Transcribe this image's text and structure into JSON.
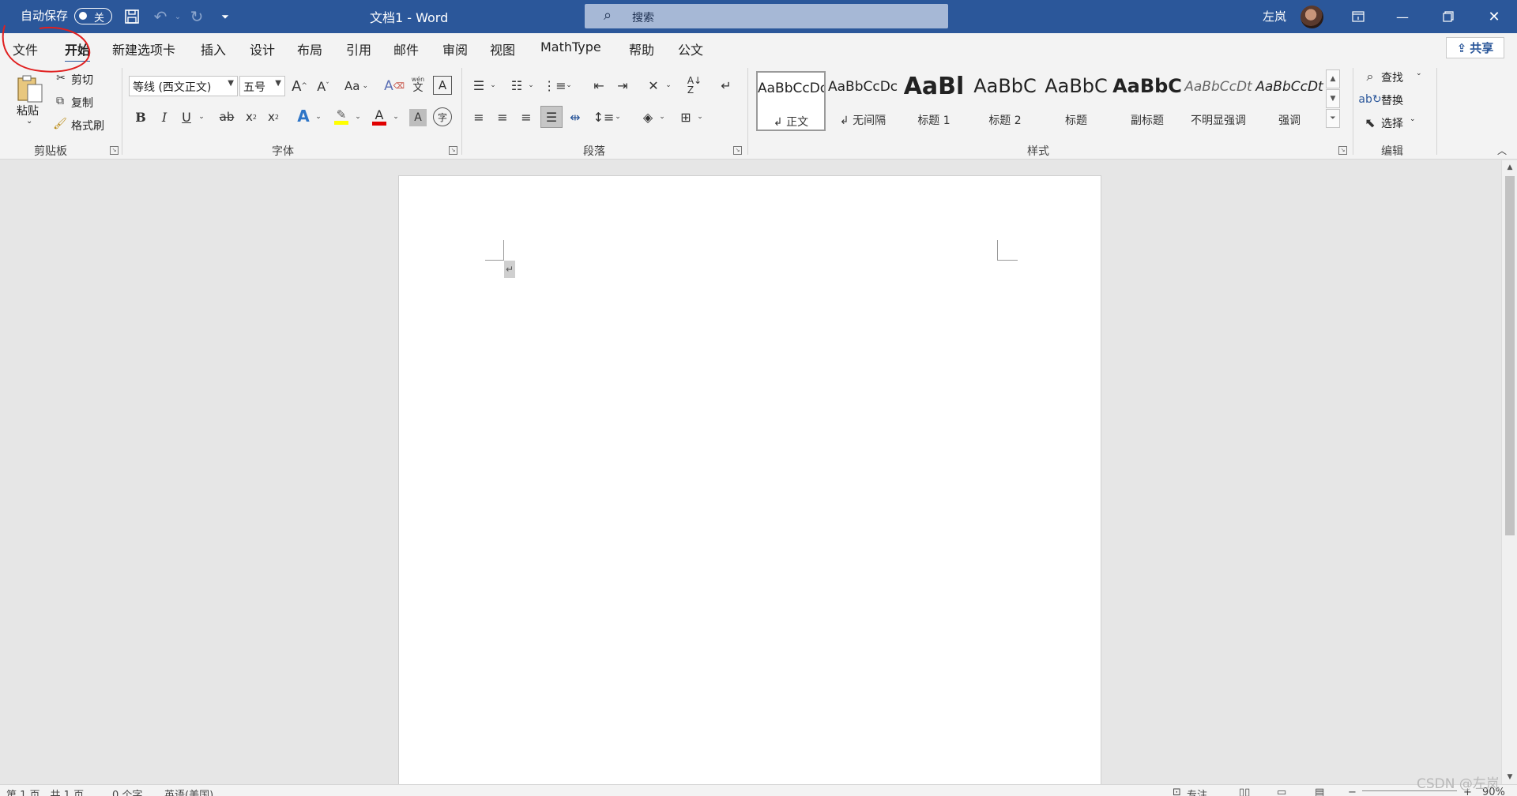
{
  "titlebar": {
    "autosave_label": "自动保存",
    "autosave_state": "关",
    "doc_title": "文档1  -  Word",
    "search_placeholder": "搜索",
    "user_name": "左岚",
    "brand_color": "#2b579a"
  },
  "tabs": [
    {
      "label": "文件",
      "active": false
    },
    {
      "label": "开始",
      "active": true
    },
    {
      "label": "新建选项卡",
      "active": false
    },
    {
      "label": "插入",
      "active": false
    },
    {
      "label": "设计",
      "active": false
    },
    {
      "label": "布局",
      "active": false
    },
    {
      "label": "引用",
      "active": false
    },
    {
      "label": "邮件",
      "active": false
    },
    {
      "label": "审阅",
      "active": false
    },
    {
      "label": "视图",
      "active": false
    },
    {
      "label": "MathType",
      "active": false
    },
    {
      "label": "帮助",
      "active": false
    },
    {
      "label": "公文",
      "active": false
    }
  ],
  "share_label": "共享",
  "clipboard": {
    "group_label": "剪贴板",
    "paste": "粘贴",
    "cut": "剪切",
    "copy": "复制",
    "format_painter": "格式刷"
  },
  "font": {
    "group_label": "字体",
    "font_name": "等线 (西文正文)",
    "font_size": "五号",
    "change_case": "Aa",
    "phonetic_top": "wén",
    "phonetic_bottom": "文"
  },
  "paragraph": {
    "group_label": "段落"
  },
  "styles": {
    "group_label": "样式",
    "items": [
      {
        "preview": "AaBbCcDc",
        "name": "↲ 正文",
        "selected": true
      },
      {
        "preview": "AaBbCcDc",
        "name": "↲ 无间隔",
        "selected": false
      },
      {
        "preview": "AaBl",
        "name": "标题 1",
        "selected": false
      },
      {
        "preview": "AaBbC",
        "name": "标题 2",
        "selected": false
      },
      {
        "preview": "AaBbC",
        "name": "标题",
        "selected": false
      },
      {
        "preview": "AaBbC",
        "name": "副标题",
        "selected": false
      },
      {
        "preview": "AaBbCcDt",
        "name": "不明显强调",
        "selected": false
      },
      {
        "preview": "AaBbCcDt",
        "name": "强调",
        "selected": false
      }
    ]
  },
  "editing": {
    "group_label": "编辑",
    "find": "查找",
    "replace": "替换",
    "select": "选择"
  },
  "statusbar": {
    "page": "第 1 页，共 1 页",
    "words": "0 个字",
    "language": "英语(美国)",
    "focus": "专注",
    "zoom": "90%"
  },
  "watermark": "CSDN @左岚"
}
